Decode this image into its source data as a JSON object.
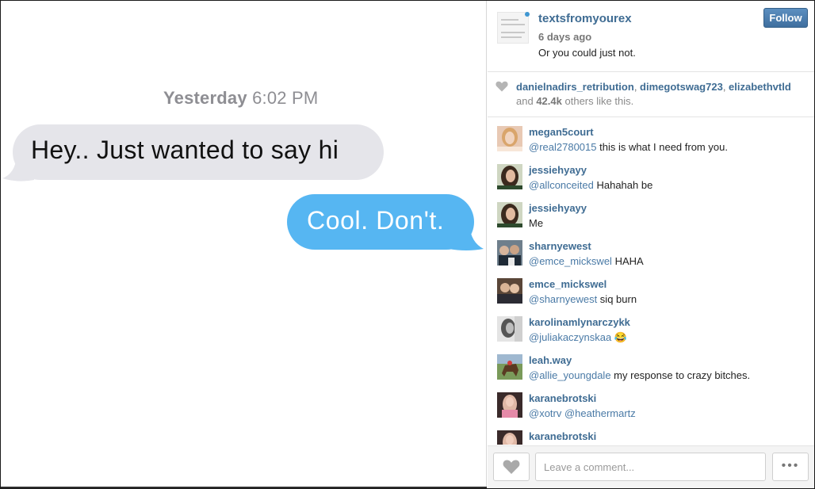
{
  "image": {
    "timestamp_day": "Yesterday",
    "timestamp_time": "6:02 PM",
    "received_message": "Hey.. Just wanted to say hi",
    "sent_message": "Cool. Don't."
  },
  "post": {
    "username": "textsfromyourex",
    "time_ago": "6 days ago",
    "caption": "Or you could just not.",
    "follow_label": "Follow"
  },
  "likes": {
    "likers": [
      "danielnadirs_retribution",
      "dimegotswag723",
      "elizabethvtld"
    ],
    "and_text": "and",
    "count": "42.4k",
    "suffix": "others like this."
  },
  "comments": [
    {
      "user": "megan5court",
      "mention": "@real2780015",
      "text": " this is what I need from you.",
      "avatar": "avatar-blonde"
    },
    {
      "user": "jessiehyayy",
      "mention": "@allconceited",
      "text": " Hahahah be",
      "avatar": "avatar-brunette"
    },
    {
      "user": "jessiehyayy",
      "mention": "",
      "text": "Me",
      "avatar": "avatar-brunette"
    },
    {
      "user": "sharnyewest",
      "mention": "@emce_mickswel",
      "text": " HAHA",
      "avatar": "avatar-group"
    },
    {
      "user": "emce_mickswel",
      "mention": "@sharnyewest",
      "text": " siq burn",
      "avatar": "avatar-couple"
    },
    {
      "user": "karolinamlynarczykk",
      "mention": "@juliakaczynskaa",
      "text": " 😂",
      "avatar": "avatar-bw"
    },
    {
      "user": "leah.way",
      "mention": "@allie_youngdale",
      "text": " my response to crazy bitches.",
      "avatar": "avatar-horse"
    },
    {
      "user": "karanebrotski",
      "mention": "@xotrv @heathermartz",
      "text": "",
      "avatar": "avatar-pink"
    },
    {
      "user": "karanebrotski",
      "mention": "",
      "text": "",
      "avatar": "avatar-pink"
    }
  ],
  "footer": {
    "comment_placeholder": "Leave a comment...",
    "more_label": "•••"
  },
  "colors": {
    "username_blue": "#3f6c93",
    "imessage_blue": "#56b6f2",
    "imessage_gray": "#e5e5ea",
    "follow_button": "#4a7dad"
  }
}
